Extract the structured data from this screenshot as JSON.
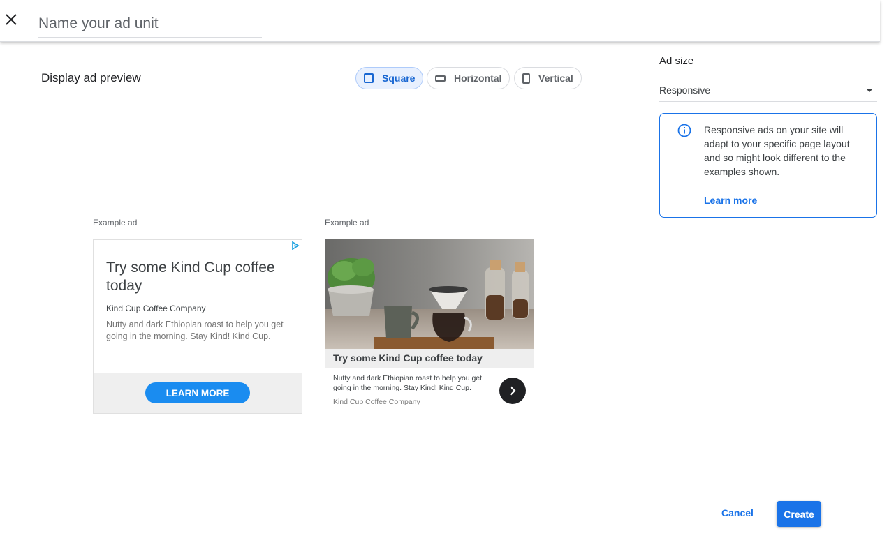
{
  "header": {
    "close_icon": "close-icon",
    "name_placeholder": "Name your ad unit"
  },
  "preview": {
    "title": "Display ad preview",
    "shapes": [
      {
        "label": "Square",
        "icon": "square-icon",
        "selected": true
      },
      {
        "label": "Horizontal",
        "icon": "horizontal-rect-icon",
        "selected": false
      },
      {
        "label": "Vertical",
        "icon": "vertical-rect-icon",
        "selected": false
      }
    ],
    "example_label": "Example ad",
    "ad1": {
      "headline": "Try some Kind Cup coffee today",
      "advertiser": "Kind Cup Coffee Company",
      "description": "Nutty and dark Ethiopian roast to help you get going in the morning. Stay Kind! Kind Cup.",
      "cta": "LEARN MORE",
      "adchoices_icon": "adchoices-icon",
      "accent": "#1a8cf0"
    },
    "ad2": {
      "headline": "Try some Kind Cup coffee today",
      "description": "Nutty and dark Ethiopian roast to help you get going in the morning. Stay Kind! Kind Cup.",
      "advertiser": "Kind Cup Coffee Company",
      "arrow_icon": "chevron-right-icon",
      "image": "coffee-photo"
    }
  },
  "sidebar": {
    "ad_size_label": "Ad size",
    "ad_size_value": "Responsive",
    "info_text": "Responsive ads on your site will adapt to your specific page layout and so might look different to the examples shown.",
    "learn_more": "Learn more",
    "cancel": "Cancel",
    "create": "Create",
    "accent": "#1a73e8"
  }
}
